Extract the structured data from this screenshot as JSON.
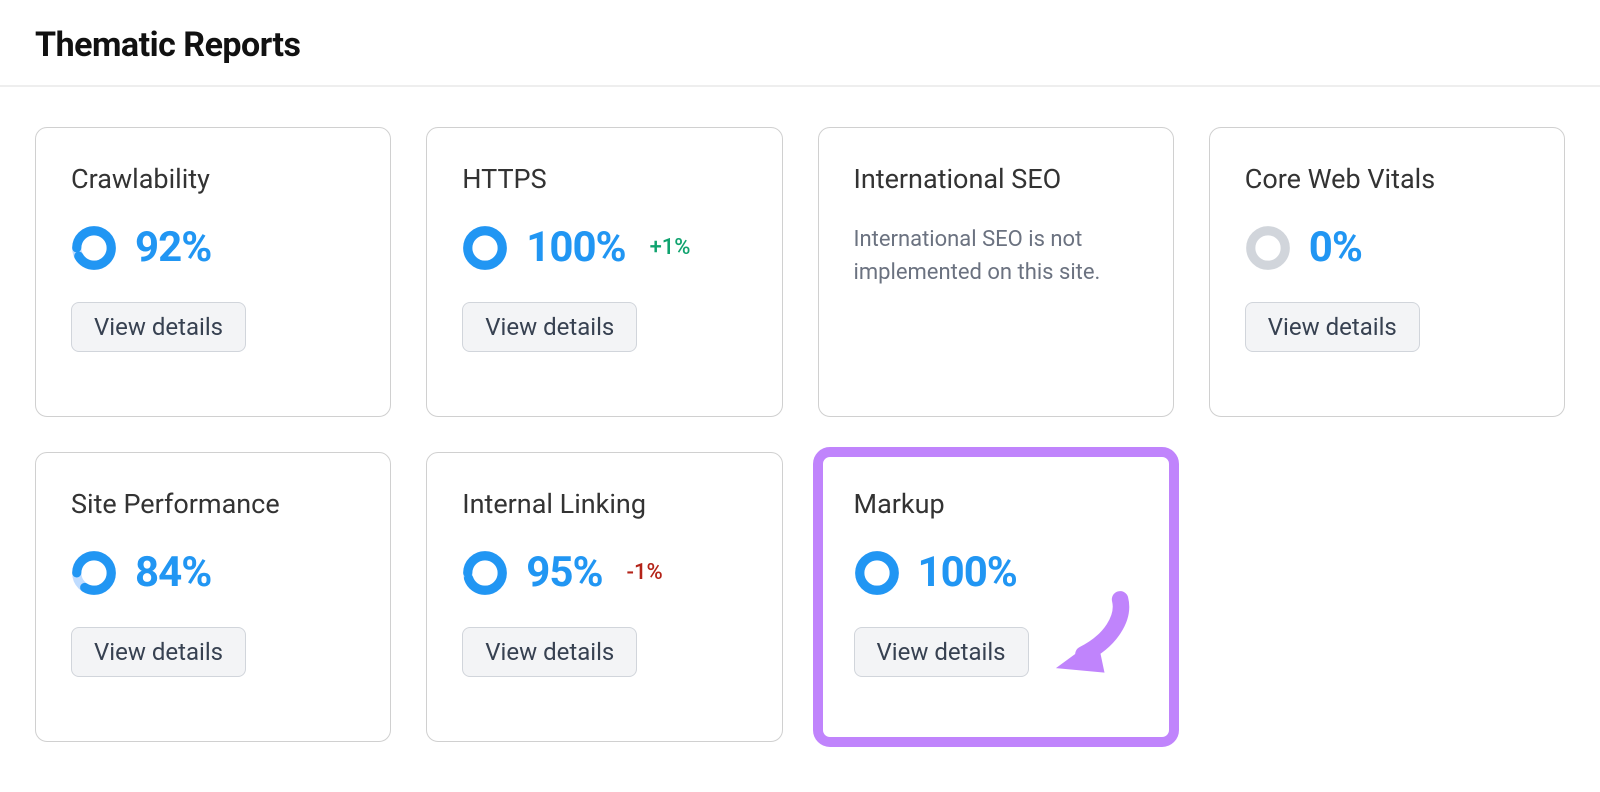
{
  "header": {
    "title": "Thematic Reports"
  },
  "view_details_label": "View details",
  "cards": {
    "crawlability": {
      "title": "Crawlability",
      "value": "92%",
      "percent": 92,
      "delta": null
    },
    "https": {
      "title": "HTTPS",
      "value": "100%",
      "percent": 100,
      "delta": "+1%",
      "delta_direction": "up"
    },
    "intl_seo": {
      "title": "International SEO",
      "message": "International SEO is not implemented on this site."
    },
    "cwv": {
      "title": "Core Web Vitals",
      "value": "0%",
      "percent": 0,
      "delta": null
    },
    "site_perf": {
      "title": "Site Performance",
      "value": "84%",
      "percent": 84,
      "delta": null
    },
    "internal_linking": {
      "title": "Internal Linking",
      "value": "95%",
      "percent": 95,
      "delta": "-1%",
      "delta_direction": "down"
    },
    "markup": {
      "title": "Markup",
      "value": "100%",
      "percent": 100,
      "delta": null,
      "highlighted": true
    }
  },
  "colors": {
    "accent_blue": "#2196f3",
    "ring_light": "#bfdcff",
    "ring_gray": "#d1d5db",
    "delta_up": "#10a36f",
    "delta_down": "#b42318",
    "highlight": "#c084fc"
  }
}
